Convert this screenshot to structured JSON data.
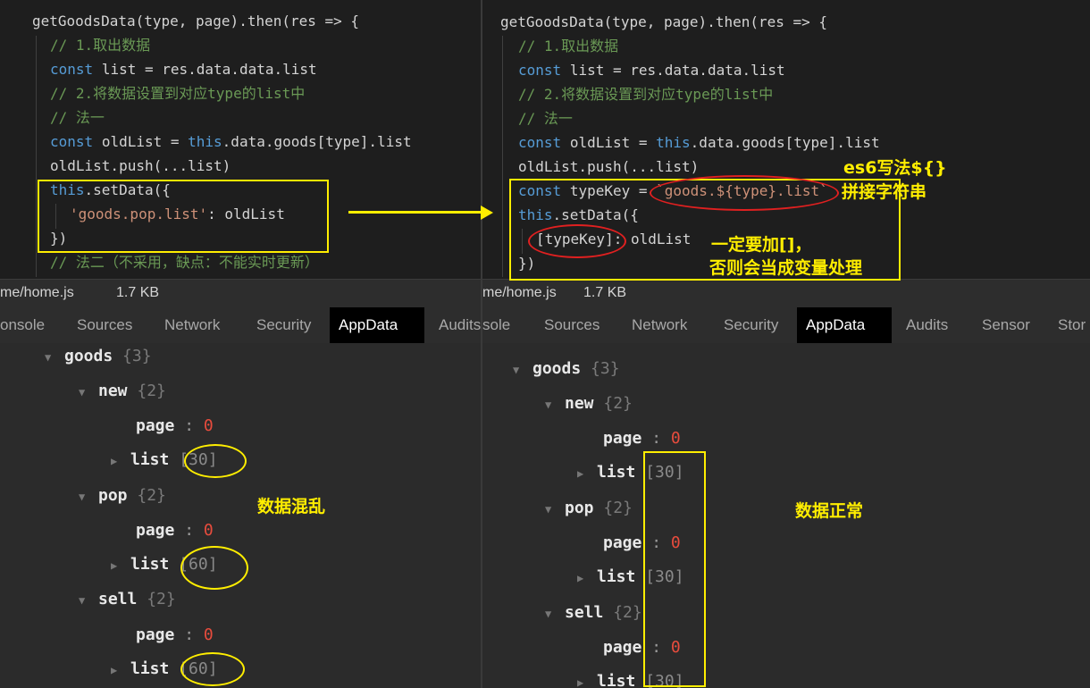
{
  "left_panel": {
    "code_lines": [
      "getGoodsData(type, page).then(res => {",
      "// 1.取出数据",
      "list = res.data.data.list",
      "// 2.将数据设置到对应type的list中",
      "// 法一",
      "oldList = ",
      ".data.goods[type].list",
      "oldList.push(...list)",
      ".setData({",
      "'goods.pop.list'",
      ": oldList",
      "})",
      "// 法二（不采用，缺点：不能实时更新）"
    ],
    "file_name": "me/home.js",
    "file_size": "1.7 KB",
    "tabs": [
      "onsole",
      "Sources",
      "Network",
      "Security",
      "AppData",
      "Audits"
    ],
    "annotation": "数据混乱",
    "tree": {
      "goods": "goods",
      "goods_count": "{3}",
      "new": "new",
      "new_count": "{2}",
      "new_page": "0",
      "new_list": "[30]",
      "pop": "pop",
      "pop_count": "{2}",
      "pop_page": "0",
      "pop_list": "[60]",
      "sell": "sell",
      "sell_count": "{2}",
      "sell_page": "0",
      "sell_list": "[60]"
    }
  },
  "right_panel": {
    "code_lines": [
      "getGoodsData(type, page).then(res => {",
      "// 1.取出数据",
      "list = res.data.data.list",
      "// 2.将数据设置到对应type的list中",
      "// 法一",
      "oldList = ",
      ".data.goods[type].list",
      "oldList.push(...list)",
      "typeKey = ",
      "`goods.${type}.list`",
      ".setData({",
      "[typeKey]: oldList",
      "})"
    ],
    "file_name": "me/home.js",
    "file_size": "1.7 KB",
    "tabs": [
      "sole",
      "Sources",
      "Network",
      "Security",
      "AppData",
      "Audits",
      "Sensor",
      "Stor"
    ],
    "annotation_es6_1": "es6写法${}",
    "annotation_es6_2": "拼接字符串",
    "annotation_brackets_1": "一定要加[]，",
    "annotation_brackets_2": "否则会当成变量处理",
    "annotation_normal": "数据正常",
    "tree": {
      "goods": "goods",
      "goods_count": "{3}",
      "new": "new",
      "new_count": "{2}",
      "new_page": "0",
      "new_list": "[30]",
      "pop": "pop",
      "pop_count": "{2}",
      "pop_page": "0",
      "pop_list": "[30]",
      "sell": "sell",
      "sell_count": "{2}",
      "sell_page": "0",
      "sell_list": "[30]"
    }
  },
  "keywords": {
    "const": "const",
    "this": "this"
  },
  "colors": {
    "annotation": "#ffee00",
    "highlight": "#e02020",
    "active_tab": "#000000"
  }
}
